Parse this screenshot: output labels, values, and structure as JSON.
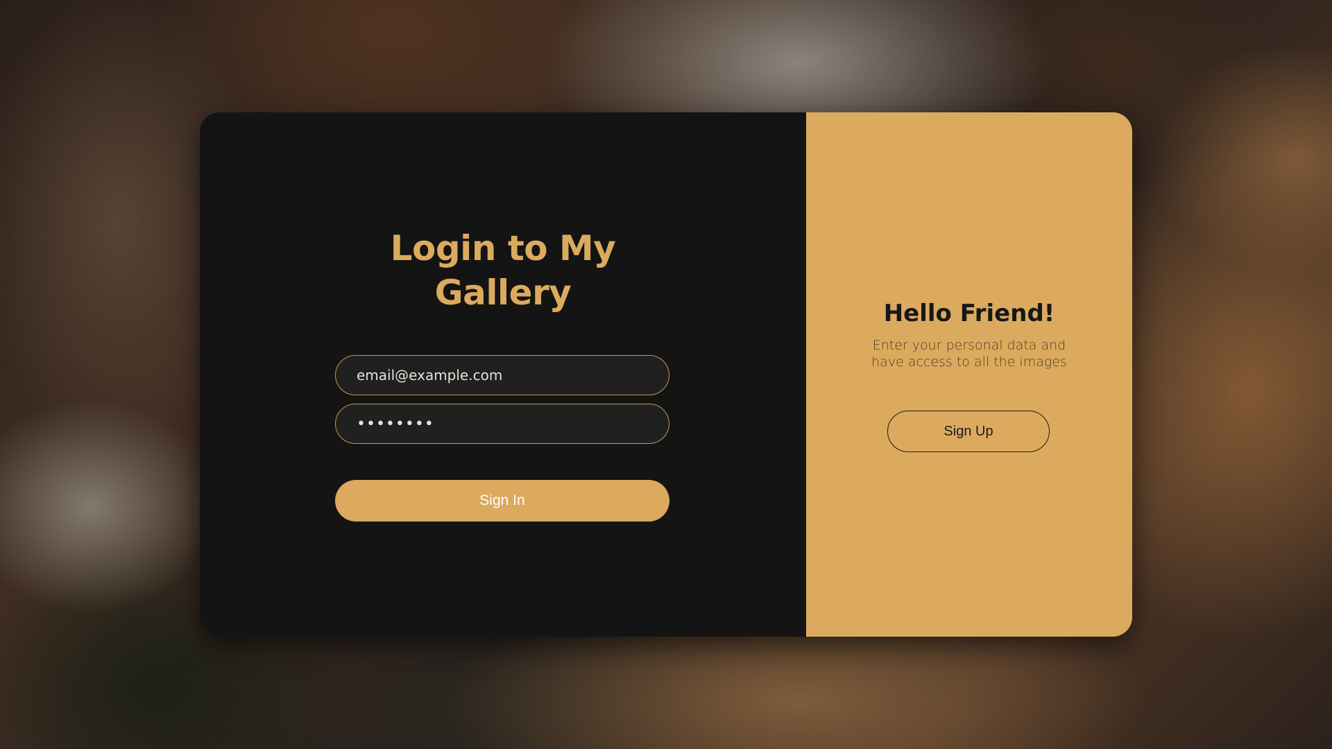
{
  "login": {
    "title_line1": "Login to My",
    "title_line2": "Gallery",
    "email_value": "email@example.com",
    "password_value": "••••••••",
    "sign_in_label": "Sign In"
  },
  "promo": {
    "title": "Hello Friend!",
    "text_line1": "Enter your personal data and",
    "text_line2": "have access to all the images",
    "sign_up_label": "Sign Up"
  },
  "colors": {
    "accent": "#dcaa5e",
    "card_dark": "#141414",
    "input_bg": "#202020"
  }
}
